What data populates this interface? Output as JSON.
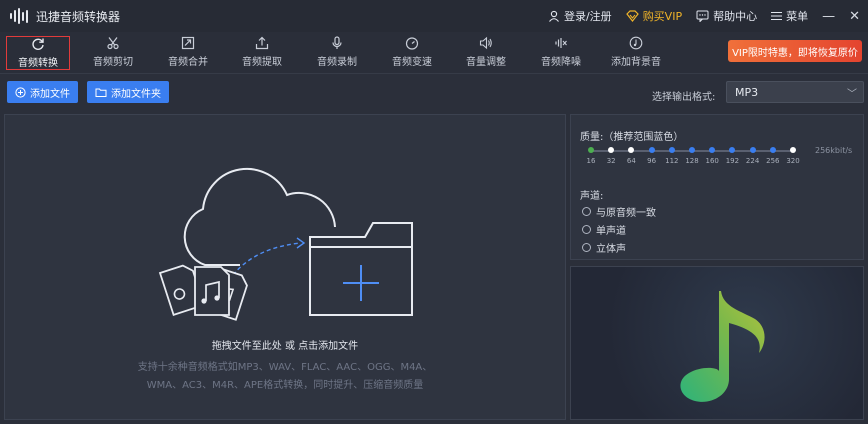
{
  "app": {
    "title": "迅捷音频转换器"
  },
  "titlebar": {
    "login": "登录/注册",
    "buy_vip": "购买VIP",
    "help": "帮助中心",
    "menu": "菜单",
    "minimize": "—",
    "close": "✕"
  },
  "toolbar": {
    "items": [
      {
        "label": "音频转换",
        "icon": "refresh-icon",
        "active": true
      },
      {
        "label": "音频剪切",
        "icon": "scissors-icon"
      },
      {
        "label": "音频合并",
        "icon": "merge-icon"
      },
      {
        "label": "音频提取",
        "icon": "extract-icon"
      },
      {
        "label": "音频录制",
        "icon": "microphone-icon"
      },
      {
        "label": "音频变速",
        "icon": "speed-icon"
      },
      {
        "label": "音量调整",
        "icon": "volume-icon"
      },
      {
        "label": "音频降噪",
        "icon": "denoise-icon"
      },
      {
        "label": "添加背景音",
        "icon": "music-note-icon"
      }
    ],
    "vip_banner": "VIP限时特惠，即将恢复原价"
  },
  "actions": {
    "add_file": "添加文件",
    "add_folder": "添加文件夹",
    "format_label": "选择输出格式:",
    "format_value": "MP3"
  },
  "drop": {
    "main": "拖拽文件至此处 或 点击添加文件",
    "sub_line1": "支持十余种音频格式如MP3、WAV、FLAC、AAC、OGG、M4A、",
    "sub_line2": "WMA、AC3、M4R、APE格式转换，同时提升、压缩音频质量"
  },
  "settings": {
    "quality_label": "质量:（推荐范围蓝色）",
    "quality_ticks": [
      "16",
      "32",
      "64",
      "96",
      "112",
      "128",
      "160",
      "192",
      "224",
      "256",
      "320"
    ],
    "quality_rate": "256kbit/s",
    "channel_label": "声道:",
    "channels": [
      "与原音频一致",
      "单声道",
      "立体声"
    ]
  },
  "colors": {
    "accent": "#3a7ef0",
    "vip": "#f0b429",
    "active_border": "#e23b3b",
    "slider_green": "#4caf50"
  }
}
